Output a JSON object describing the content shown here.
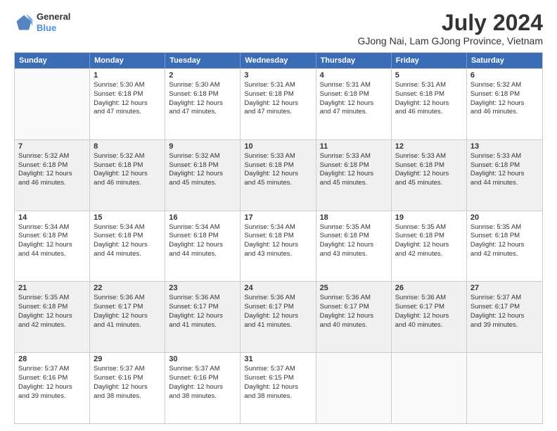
{
  "header": {
    "logo_line1": "General",
    "logo_line2": "Blue",
    "title": "July 2024",
    "subtitle": "GJong Nai, Lam GJong Province, Vietnam"
  },
  "weekdays": [
    "Sunday",
    "Monday",
    "Tuesday",
    "Wednesday",
    "Thursday",
    "Friday",
    "Saturday"
  ],
  "rows": [
    [
      {
        "day": "",
        "lines": [],
        "empty": true
      },
      {
        "day": "1",
        "lines": [
          "Sunrise: 5:30 AM",
          "Sunset: 6:18 PM",
          "Daylight: 12 hours",
          "and 47 minutes."
        ]
      },
      {
        "day": "2",
        "lines": [
          "Sunrise: 5:30 AM",
          "Sunset: 6:18 PM",
          "Daylight: 12 hours",
          "and 47 minutes."
        ]
      },
      {
        "day": "3",
        "lines": [
          "Sunrise: 5:31 AM",
          "Sunset: 6:18 PM",
          "Daylight: 12 hours",
          "and 47 minutes."
        ]
      },
      {
        "day": "4",
        "lines": [
          "Sunrise: 5:31 AM",
          "Sunset: 6:18 PM",
          "Daylight: 12 hours",
          "and 47 minutes."
        ]
      },
      {
        "day": "5",
        "lines": [
          "Sunrise: 5:31 AM",
          "Sunset: 6:18 PM",
          "Daylight: 12 hours",
          "and 46 minutes."
        ]
      },
      {
        "day": "6",
        "lines": [
          "Sunrise: 5:32 AM",
          "Sunset: 6:18 PM",
          "Daylight: 12 hours",
          "and 46 minutes."
        ]
      }
    ],
    [
      {
        "day": "7",
        "lines": [
          "Sunrise: 5:32 AM",
          "Sunset: 6:18 PM",
          "Daylight: 12 hours",
          "and 46 minutes."
        ],
        "shaded": true
      },
      {
        "day": "8",
        "lines": [
          "Sunrise: 5:32 AM",
          "Sunset: 6:18 PM",
          "Daylight: 12 hours",
          "and 46 minutes."
        ],
        "shaded": true
      },
      {
        "day": "9",
        "lines": [
          "Sunrise: 5:32 AM",
          "Sunset: 6:18 PM",
          "Daylight: 12 hours",
          "and 45 minutes."
        ],
        "shaded": true
      },
      {
        "day": "10",
        "lines": [
          "Sunrise: 5:33 AM",
          "Sunset: 6:18 PM",
          "Daylight: 12 hours",
          "and 45 minutes."
        ],
        "shaded": true
      },
      {
        "day": "11",
        "lines": [
          "Sunrise: 5:33 AM",
          "Sunset: 6:18 PM",
          "Daylight: 12 hours",
          "and 45 minutes."
        ],
        "shaded": true
      },
      {
        "day": "12",
        "lines": [
          "Sunrise: 5:33 AM",
          "Sunset: 6:18 PM",
          "Daylight: 12 hours",
          "and 45 minutes."
        ],
        "shaded": true
      },
      {
        "day": "13",
        "lines": [
          "Sunrise: 5:33 AM",
          "Sunset: 6:18 PM",
          "Daylight: 12 hours",
          "and 44 minutes."
        ],
        "shaded": true
      }
    ],
    [
      {
        "day": "14",
        "lines": [
          "Sunrise: 5:34 AM",
          "Sunset: 6:18 PM",
          "Daylight: 12 hours",
          "and 44 minutes."
        ]
      },
      {
        "day": "15",
        "lines": [
          "Sunrise: 5:34 AM",
          "Sunset: 6:18 PM",
          "Daylight: 12 hours",
          "and 44 minutes."
        ]
      },
      {
        "day": "16",
        "lines": [
          "Sunrise: 5:34 AM",
          "Sunset: 6:18 PM",
          "Daylight: 12 hours",
          "and 44 minutes."
        ]
      },
      {
        "day": "17",
        "lines": [
          "Sunrise: 5:34 AM",
          "Sunset: 6:18 PM",
          "Daylight: 12 hours",
          "and 43 minutes."
        ]
      },
      {
        "day": "18",
        "lines": [
          "Sunrise: 5:35 AM",
          "Sunset: 6:18 PM",
          "Daylight: 12 hours",
          "and 43 minutes."
        ]
      },
      {
        "day": "19",
        "lines": [
          "Sunrise: 5:35 AM",
          "Sunset: 6:18 PM",
          "Daylight: 12 hours",
          "and 42 minutes."
        ]
      },
      {
        "day": "20",
        "lines": [
          "Sunrise: 5:35 AM",
          "Sunset: 6:18 PM",
          "Daylight: 12 hours",
          "and 42 minutes."
        ]
      }
    ],
    [
      {
        "day": "21",
        "lines": [
          "Sunrise: 5:35 AM",
          "Sunset: 6:18 PM",
          "Daylight: 12 hours",
          "and 42 minutes."
        ],
        "shaded": true
      },
      {
        "day": "22",
        "lines": [
          "Sunrise: 5:36 AM",
          "Sunset: 6:17 PM",
          "Daylight: 12 hours",
          "and 41 minutes."
        ],
        "shaded": true
      },
      {
        "day": "23",
        "lines": [
          "Sunrise: 5:36 AM",
          "Sunset: 6:17 PM",
          "Daylight: 12 hours",
          "and 41 minutes."
        ],
        "shaded": true
      },
      {
        "day": "24",
        "lines": [
          "Sunrise: 5:36 AM",
          "Sunset: 6:17 PM",
          "Daylight: 12 hours",
          "and 41 minutes."
        ],
        "shaded": true
      },
      {
        "day": "25",
        "lines": [
          "Sunrise: 5:36 AM",
          "Sunset: 6:17 PM",
          "Daylight: 12 hours",
          "and 40 minutes."
        ],
        "shaded": true
      },
      {
        "day": "26",
        "lines": [
          "Sunrise: 5:36 AM",
          "Sunset: 6:17 PM",
          "Daylight: 12 hours",
          "and 40 minutes."
        ],
        "shaded": true
      },
      {
        "day": "27",
        "lines": [
          "Sunrise: 5:37 AM",
          "Sunset: 6:17 PM",
          "Daylight: 12 hours",
          "and 39 minutes."
        ],
        "shaded": true
      }
    ],
    [
      {
        "day": "28",
        "lines": [
          "Sunrise: 5:37 AM",
          "Sunset: 6:16 PM",
          "Daylight: 12 hours",
          "and 39 minutes."
        ]
      },
      {
        "day": "29",
        "lines": [
          "Sunrise: 5:37 AM",
          "Sunset: 6:16 PM",
          "Daylight: 12 hours",
          "and 38 minutes."
        ]
      },
      {
        "day": "30",
        "lines": [
          "Sunrise: 5:37 AM",
          "Sunset: 6:16 PM",
          "Daylight: 12 hours",
          "and 38 minutes."
        ]
      },
      {
        "day": "31",
        "lines": [
          "Sunrise: 5:37 AM",
          "Sunset: 6:15 PM",
          "Daylight: 12 hours",
          "and 38 minutes."
        ]
      },
      {
        "day": "",
        "lines": [],
        "empty": true
      },
      {
        "day": "",
        "lines": [],
        "empty": true
      },
      {
        "day": "",
        "lines": [],
        "empty": true
      }
    ]
  ]
}
